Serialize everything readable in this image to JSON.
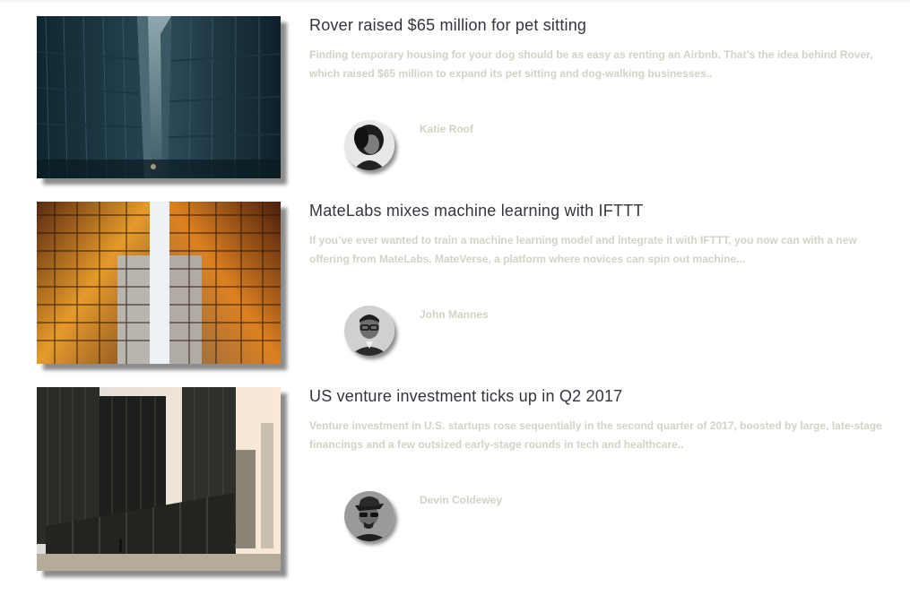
{
  "articles": [
    {
      "title": "Rover raised $65 million for pet sitting",
      "excerpt": "Finding temporary housing for your dog should be as easy as renting an Airbnb. That’s the idea behind Rover, which raised $65 million to expand its pet sitting and dog-walking businesses..",
      "author": "Katie Roof",
      "image_icon": "city-street-photo",
      "avatar_icon": "author-avatar"
    },
    {
      "title": "MateLabs mixes machine learning with IFTTT",
      "excerpt": "If you’ve ever wanted to train a machine learning model and integrate it with IFTTT, you now can with a new offering from MateLabs. MateVerse, a platform where novices can spin out machine...",
      "author": "John Mannes",
      "image_icon": "glass-towers-photo",
      "avatar_icon": "author-avatar"
    },
    {
      "title": "US venture investment ticks up in Q2 2017",
      "excerpt": "Venture investment in U.S. startups rose sequentially in the second quarter of 2017, boosted by large, late-stage financings and a few outsized early-stage rounds in tech and healthcare..",
      "author": "Devin Coldewey",
      "image_icon": "office-buildings-photo",
      "avatar_icon": "author-avatar"
    }
  ],
  "colors": {
    "title": "#34343e",
    "muted_text": "#cfd5c4",
    "background": "#ffffff"
  }
}
